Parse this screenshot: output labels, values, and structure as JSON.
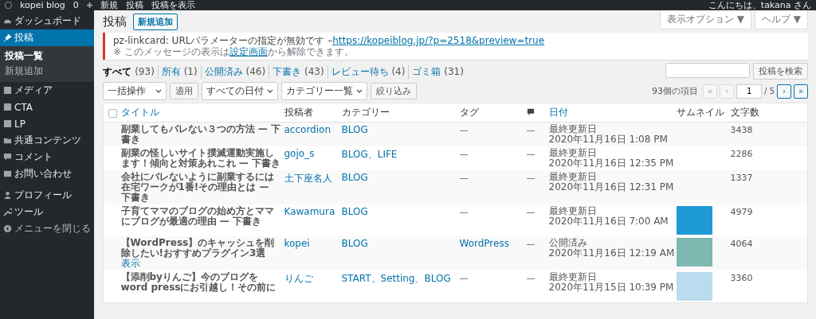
{
  "admin_bar": {
    "site": "kopei blog",
    "comments": "0",
    "new": "新規",
    "posts": "投稿",
    "view": "投稿を表示",
    "greeting": "こんにちは、takana さん"
  },
  "sidebar": {
    "items": [
      {
        "label": "ダッシュボード",
        "selected": false
      },
      {
        "label": "投稿",
        "selected": true,
        "children": [
          {
            "label": "投稿一覧",
            "selected": true
          },
          {
            "label": "新規追加",
            "selected": false
          }
        ]
      },
      {
        "label": "メディア",
        "selected": false
      },
      {
        "label": "CTA",
        "selected": false
      },
      {
        "label": "LP",
        "selected": false
      },
      {
        "label": "共通コンテンツ",
        "selected": false
      },
      {
        "label": "コメント",
        "selected": false
      },
      {
        "label": "お問い合わせ",
        "selected": false
      },
      {
        "label": "プロフィール",
        "selected": false
      },
      {
        "label": "ツール",
        "selected": false
      },
      {
        "label": "メニューを閉じる",
        "selected": false
      }
    ]
  },
  "screen_tabs": [
    "表示オプション ▼",
    "ヘルプ ▼"
  ],
  "heading": {
    "title": "投稿",
    "add_new": "新規追加"
  },
  "notice": {
    "message": "pz-linkcard: URLパラメーターの指定が無効です –",
    "url": "https://kopeiblog.jp/?p=2518&preview=true",
    "hint_before": "※ このメッセージの表示は",
    "hint_link": "設定画面",
    "hint_after": "から解除できます。"
  },
  "filters": [
    {
      "label": "すべて",
      "count": "(93)",
      "selected": true
    },
    {
      "label": "所有",
      "count": "(1)",
      "selected": false
    },
    {
      "label": "公開済み",
      "count": "(46)",
      "selected": false
    },
    {
      "label": "下書き",
      "count": "(43)",
      "selected": false
    },
    {
      "label": "レビュー待ち",
      "count": "(4)",
      "selected": false
    },
    {
      "label": "ゴミ箱",
      "count": "(31)",
      "selected": false
    }
  ],
  "search": {
    "button": "投稿を検索"
  },
  "actions": {
    "bulk": "一括操作",
    "apply": "適用",
    "dates": "すべての日付",
    "categories": "カテゴリー一覧",
    "filter": "絞り込み"
  },
  "pagination": {
    "items": "93個の項目",
    "first": "«",
    "prev": "‹",
    "page": "1",
    "total": "/ 5",
    "next": "›",
    "last": "»",
    "first_disabled": true,
    "prev_disabled": true
  },
  "table": {
    "select_all": {
      "checked": false
    },
    "columns": [
      {
        "label": "タイトル",
        "sortable": true
      },
      {
        "label": "投稿者",
        "sortable": false
      },
      {
        "label": "カテゴリー",
        "sortable": false
      },
      {
        "label": "タグ",
        "sortable": false
      },
      {
        "sortable": false,
        "kind": "comments"
      },
      {
        "label": "日付",
        "sortable": true
      },
      {
        "label": "サムネイル",
        "sortable": false
      },
      {
        "label": "文字数",
        "sortable": false
      }
    ],
    "rows": [
      {
        "title": "副業してもバレない３つの方法 — 下書き",
        "action": "",
        "author": "accordion",
        "categories": "BLOG",
        "tags": "—",
        "comments": "—",
        "status": "最終更新日",
        "date": "2020年11月16日 1:08 PM",
        "thumbnail": false,
        "words": "3438"
      },
      {
        "title": "副業の怪しいサイト撲滅運動実施します！傾向と対策あれこれ — 下書き",
        "action": "",
        "author": "gojo_s",
        "categories": "BLOG、LIFE",
        "tags": "—",
        "comments": "—",
        "status": "最終更新日",
        "date": "2020年11月16日 12:35 PM",
        "thumbnail": false,
        "words": "2286"
      },
      {
        "title": "会社にバレないように副業するには在宅ワークが1番!その理由とは — 下書き",
        "action": "",
        "author": "土下座名人",
        "categories": "BLOG",
        "tags": "—",
        "comments": "—",
        "status": "最終更新日",
        "date": "2020年11月16日 12:31 PM",
        "thumbnail": false,
        "words": "1337"
      },
      {
        "title": "子育てママのブログの始め方とママにブログが最適の理由 — 下書き",
        "action": "",
        "author": "Kawamura",
        "categories": "BLOG",
        "tags": "—",
        "comments": "—",
        "status": "最終更新日",
        "date": "2020年11月16日 7:00 AM",
        "thumbnail": true,
        "words": "4979"
      },
      {
        "title": "【WordPress】のキャッシュを削除したい!おすすめプラグイン3選",
        "action": "表示",
        "author": "kopei",
        "categories": "BLOG",
        "tags": "WordPress",
        "comments": "—",
        "status": "公開済み",
        "date": "2020年11月16日 12:19 AM",
        "thumbnail": true,
        "words": "4064"
      },
      {
        "title": "【添削byりんご】今のブログを word pressにお引越し！その前に",
        "action": "",
        "author": "りんご",
        "categories": "START、Setting、BLOG",
        "tags": "—",
        "comments": "—",
        "status": "最終更新日",
        "date": "2020年11月15日 10:39 PM",
        "thumbnail": true,
        "words": "3360"
      }
    ]
  }
}
